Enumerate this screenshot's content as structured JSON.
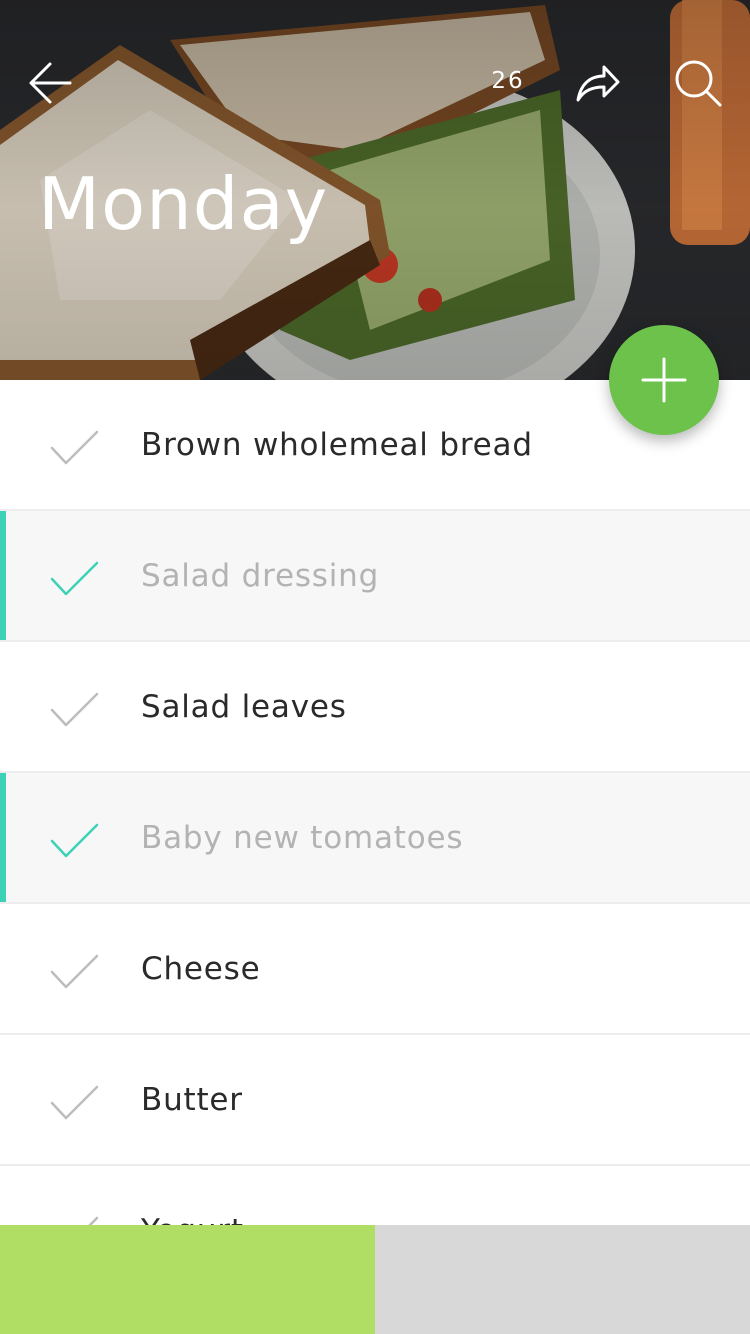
{
  "header": {
    "title": "Monday",
    "count": "26",
    "icons": {
      "back": "arrow-left-icon",
      "share": "share-arrow-icon",
      "search": "search-icon"
    }
  },
  "fab": {
    "icon": "plus-icon",
    "color": "#6cc24a"
  },
  "colors": {
    "accent": "#3dd1b6",
    "unchecked": "#bdbdbd",
    "done_text": "#b3b3b3",
    "text": "#2a2a2a",
    "bottom_left": "#b0dd64",
    "bottom_right": "#d8d8d8"
  },
  "items": [
    {
      "label": "Brown wholemeal bread",
      "done": false
    },
    {
      "label": "Salad dressing",
      "done": true
    },
    {
      "label": "Salad leaves",
      "done": false
    },
    {
      "label": "Baby new tomatoes",
      "done": true
    },
    {
      "label": "Cheese",
      "done": false
    },
    {
      "label": "Butter",
      "done": false
    },
    {
      "label": "Yogurt",
      "done": false
    }
  ]
}
